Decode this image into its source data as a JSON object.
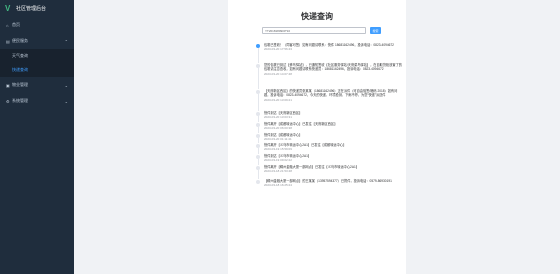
{
  "app": {
    "title": "社区管理后台"
  },
  "sidebar": {
    "items": [
      {
        "label": "首页",
        "icon": "home-icon"
      },
      {
        "label": "便民服务",
        "icon": "service-icon",
        "expanded": true,
        "children": [
          {
            "label": "天气查询",
            "active": false
          },
          {
            "label": "快递查询",
            "active": true
          }
        ]
      },
      {
        "label": "物业管理",
        "icon": "property-icon",
        "expanded": false
      },
      {
        "label": "系统管理",
        "icon": "system-icon",
        "expanded": false
      }
    ]
  },
  "page": {
    "title": "快递查询"
  },
  "search": {
    "value": "YT2018180900*10",
    "button_label": "搜索"
  },
  "timeline": [
    {
      "content": "包裹已签收！（同客可签）如有问题请联系：快件 18681162496，投诉电话：0823-4094672",
      "time": "2023-03-20 17:56:43"
    },
    {
      "content": "您的包裹已到达【蜂鸟驿站】，已通知签收【社区服务驿站/天府菜鸟驿站】，在自取货柜放置了的包裹请注意查收，如有问题请联系快递员：18681162496，投诉电话：0823-4094672",
      "time": "2023-03-20 14:07:48"
    },
    {
      "content": "【天府新区西区】的快递员张某某（18681162496）正在派件（可自由验签/暗码 2018）如有问题，投诉电话：0823-4094672，今天的快递、环境检测、下雨不停，为您“快递”派送件",
      "time": "2023-03-20 13:09:21"
    },
    {
      "content": "快件到达【天府新区西区】",
      "time": "2023-03-20 13:03:31"
    },
    {
      "content": "快件离开【成都转运中心】已发往【天府新区西区】",
      "time": "2023-03-20 06:00:38"
    },
    {
      "content": "快件到达【成都转运中心】",
      "time": "2023-03-20 01:11:41"
    },
    {
      "content": "快件离开【义乌市转运中心2A1】已发往【成都转运中心】",
      "time": "2023-03-19 15:59:09"
    },
    {
      "content": "快件到达【义乌市转运中心2A1】",
      "time": "2023-03-19 09:02:22"
    },
    {
      "content": "快件离开【稠州金融大厦一部网点】已发往【义乌市转运中心2A1】",
      "time": "2023-03-18 21:53:48"
    },
    {
      "content": "【稠州金融大厦一部网点】的王某某（13957594377）已揽件，投诉电话：0579-86930191",
      "time": "2023-03-18 16:25:24"
    }
  ],
  "colors": {
    "sidebar_bg": "#1f2d3d",
    "accent": "#409eff",
    "brand": "#42b983"
  }
}
